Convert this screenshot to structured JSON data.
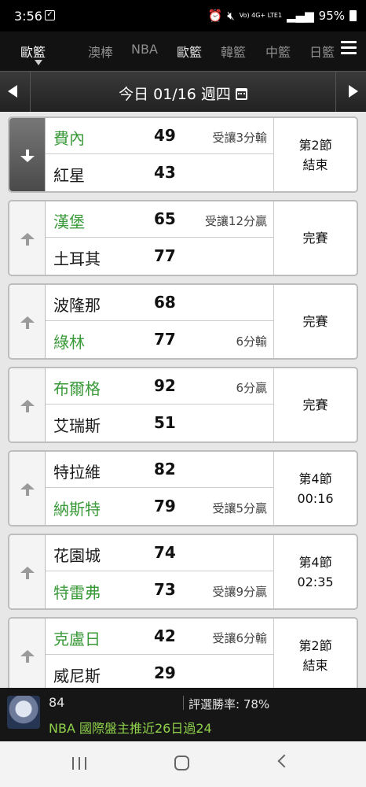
{
  "status_bar": {
    "time": "3:56",
    "network": "Vo) 4G+ LTE1",
    "battery": "95%"
  },
  "league_tabs": {
    "current": "歐籃",
    "items": [
      "澳棒",
      "NBA",
      "歐籃",
      "韓籃",
      "中籃",
      "日籃"
    ],
    "selected_index": 2
  },
  "date_bar": {
    "label": "今日 01/16 週四"
  },
  "games": [
    {
      "expanded": true,
      "home": {
        "team": "費內",
        "score": "49",
        "note": "受讓3分輸",
        "highlight": true
      },
      "away": {
        "team": "紅星",
        "score": "43",
        "note": "",
        "highlight": false
      },
      "status_line1": "第2節",
      "status_line2": "結束"
    },
    {
      "expanded": false,
      "home": {
        "team": "漢堡",
        "score": "65",
        "note": "受讓12分贏",
        "highlight": true
      },
      "away": {
        "team": "土耳其",
        "score": "77",
        "note": "",
        "highlight": false
      },
      "status_line1": "完賽",
      "status_line2": ""
    },
    {
      "expanded": false,
      "home": {
        "team": "波隆那",
        "score": "68",
        "note": "",
        "highlight": false
      },
      "away": {
        "team": "綠林",
        "score": "77",
        "note": "6分輸",
        "highlight": true
      },
      "status_line1": "完賽",
      "status_line2": ""
    },
    {
      "expanded": false,
      "home": {
        "team": "布爾格",
        "score": "92",
        "note": "6分贏",
        "highlight": true
      },
      "away": {
        "team": "艾瑞斯",
        "score": "51",
        "note": "",
        "highlight": false
      },
      "status_line1": "完賽",
      "status_line2": ""
    },
    {
      "expanded": false,
      "home": {
        "team": "特拉維",
        "score": "82",
        "note": "",
        "highlight": false
      },
      "away": {
        "team": "納斯特",
        "score": "79",
        "note": "受讓5分贏",
        "highlight": true
      },
      "status_line1": "第4節",
      "status_line2": "00:16"
    },
    {
      "expanded": false,
      "home": {
        "team": "花園城",
        "score": "74",
        "note": "",
        "highlight": false
      },
      "away": {
        "team": "特雷弗",
        "score": "73",
        "note": "受讓9分贏",
        "highlight": true
      },
      "status_line1": "第4節",
      "status_line2": "02:35"
    },
    {
      "expanded": false,
      "home": {
        "team": "克盧日",
        "score": "42",
        "note": "受讓6分輸",
        "highlight": true
      },
      "away": {
        "team": "威尼斯",
        "score": "29",
        "note": "",
        "highlight": false
      },
      "status_line1": "第2節",
      "status_line2": "結束"
    }
  ],
  "info_bar": {
    "number": "84",
    "win_rate": "評選勝率: 78%",
    "tip": "NBA 國際盤主推近26日過24"
  },
  "colors": {
    "highlight_team": "#3a9a3a",
    "tip_text": "#8fd14a"
  }
}
